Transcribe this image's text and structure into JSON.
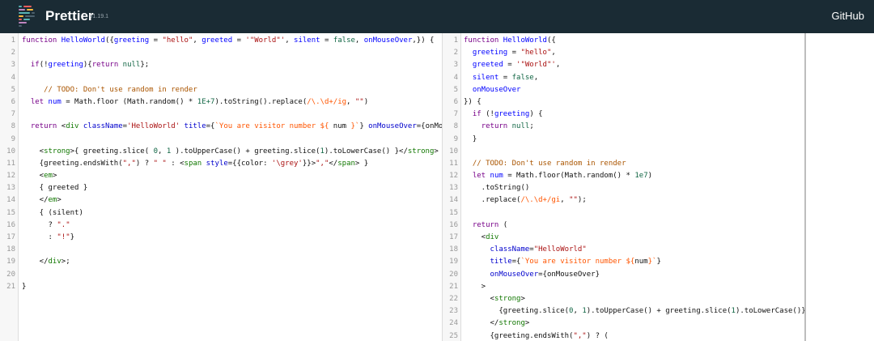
{
  "header": {
    "title": "Prettier",
    "version": "v1.19.1",
    "github_label": "GitHub"
  },
  "colors": {
    "header_bg": "#1a2b34",
    "keyword": "#770088",
    "def": "#0000ff",
    "string": "#aa1111",
    "comment": "#aa5500",
    "tag": "#117700",
    "attr": "#0000cc",
    "number": "#116644",
    "string2": "#ff5500"
  },
  "input": {
    "lines": [
      [
        {
          "t": "function ",
          "c": "kw"
        },
        {
          "t": "HelloWorld",
          "c": "def"
        },
        {
          "t": "({"
        },
        {
          "t": "greeting",
          "c": "def"
        },
        {
          "t": " = "
        },
        {
          "t": "\"hello\"",
          "c": "str"
        },
        {
          "t": ", "
        },
        {
          "t": "greeted",
          "c": "def"
        },
        {
          "t": " = "
        },
        {
          "t": "'\"World\"'",
          "c": "str"
        },
        {
          "t": ", "
        },
        {
          "t": "silent",
          "c": "def"
        },
        {
          "t": " = "
        },
        {
          "t": "false",
          "c": "atom"
        },
        {
          "t": ", "
        },
        {
          "t": "onMouseOver",
          "c": "def"
        },
        {
          "t": ",}) {"
        }
      ],
      [],
      [
        {
          "t": "  "
        },
        {
          "t": "if",
          "c": "kw"
        },
        {
          "t": "(!"
        },
        {
          "t": "greeting",
          "c": "var2"
        },
        {
          "t": "){"
        },
        {
          "t": "return",
          "c": "kw"
        },
        {
          "t": " "
        },
        {
          "t": "null",
          "c": "atom"
        },
        {
          "t": "};"
        }
      ],
      [],
      [
        {
          "t": "     "
        },
        {
          "t": "// TODO: Don't use random in render",
          "c": "com"
        }
      ],
      [
        {
          "t": "  "
        },
        {
          "t": "let",
          "c": "kw"
        },
        {
          "t": " "
        },
        {
          "t": "num",
          "c": "def"
        },
        {
          "t": " = Math.floor (Math.random() * "
        },
        {
          "t": "1E+7",
          "c": "num"
        },
        {
          "t": ").toString().replace("
        },
        {
          "t": "/\\.\\d+/ig",
          "c": "str2"
        },
        {
          "t": ", "
        },
        {
          "t": "\"\"",
          "c": "str"
        },
        {
          "t": ")"
        }
      ],
      [],
      [
        {
          "t": "  "
        },
        {
          "t": "return",
          "c": "kw"
        },
        {
          "t": " <"
        },
        {
          "t": "div",
          "c": "tag"
        },
        {
          "t": " "
        },
        {
          "t": "className",
          "c": "attr"
        },
        {
          "t": "="
        },
        {
          "t": "'HelloWorld'",
          "c": "str"
        },
        {
          "t": " "
        },
        {
          "t": "title",
          "c": "attr"
        },
        {
          "t": "={"
        },
        {
          "t": "`You are visitor number ${",
          "c": "str2"
        },
        {
          "t": " num ",
          "c": "v"
        },
        {
          "t": "}`",
          "c": "str2"
        },
        {
          "t": "} "
        },
        {
          "t": "onMouseOver",
          "c": "attr"
        },
        {
          "t": "={onMouseOver}>"
        }
      ],
      [],
      [
        {
          "t": "    <"
        },
        {
          "t": "strong",
          "c": "tag"
        },
        {
          "t": ">{ greeting.slice( "
        },
        {
          "t": "0",
          "c": "num"
        },
        {
          "t": ", "
        },
        {
          "t": "1",
          "c": "num"
        },
        {
          "t": " ).toUpperCase() + greeting.slice("
        },
        {
          "t": "1",
          "c": "num"
        },
        {
          "t": ").toLowerCase() }</"
        },
        {
          "t": "strong",
          "c": "tag"
        },
        {
          "t": ">"
        }
      ],
      [
        {
          "t": "    {greeting.endsWith("
        },
        {
          "t": "\",\"",
          "c": "str"
        },
        {
          "t": ") ? "
        },
        {
          "t": "\" \"",
          "c": "str"
        },
        {
          "t": " : <"
        },
        {
          "t": "span",
          "c": "tag"
        },
        {
          "t": " "
        },
        {
          "t": "style",
          "c": "attr"
        },
        {
          "t": "={{color: "
        },
        {
          "t": "'\\grey'",
          "c": "str"
        },
        {
          "t": "}}>"
        },
        {
          "t": "\",\"",
          "c": "str"
        },
        {
          "t": "</"
        },
        {
          "t": "span",
          "c": "tag"
        },
        {
          "t": "> }"
        }
      ],
      [
        {
          "t": "    <"
        },
        {
          "t": "em",
          "c": "tag"
        },
        {
          "t": ">"
        }
      ],
      [
        {
          "t": "    { greeted }"
        }
      ],
      [
        {
          "t": "    </"
        },
        {
          "t": "em",
          "c": "tag"
        },
        {
          "t": ">"
        }
      ],
      [
        {
          "t": "    { (silent)"
        }
      ],
      [
        {
          "t": "      ? "
        },
        {
          "t": "\".\"",
          "c": "str"
        }
      ],
      [
        {
          "t": "      : "
        },
        {
          "t": "\"!\"",
          "c": "str"
        },
        {
          "t": "}"
        }
      ],
      [],
      [
        {
          "t": "    </"
        },
        {
          "t": "div",
          "c": "tag"
        },
        {
          "t": ">;"
        }
      ],
      [],
      [
        {
          "t": "}"
        }
      ]
    ]
  },
  "output": {
    "lines": [
      [
        {
          "t": "function ",
          "c": "kw"
        },
        {
          "t": "HelloWorld",
          "c": "def"
        },
        {
          "t": "({"
        }
      ],
      [
        {
          "t": "  "
        },
        {
          "t": "greeting",
          "c": "def"
        },
        {
          "t": " = "
        },
        {
          "t": "\"hello\"",
          "c": "str"
        },
        {
          "t": ","
        }
      ],
      [
        {
          "t": "  "
        },
        {
          "t": "greeted",
          "c": "def"
        },
        {
          "t": " = "
        },
        {
          "t": "'\"World\"'",
          "c": "str"
        },
        {
          "t": ","
        }
      ],
      [
        {
          "t": "  "
        },
        {
          "t": "silent",
          "c": "def"
        },
        {
          "t": " = "
        },
        {
          "t": "false",
          "c": "atom"
        },
        {
          "t": ","
        }
      ],
      [
        {
          "t": "  "
        },
        {
          "t": "onMouseOver",
          "c": "def"
        }
      ],
      [
        {
          "t": "}) {"
        }
      ],
      [
        {
          "t": "  "
        },
        {
          "t": "if",
          "c": "kw"
        },
        {
          "t": " (!"
        },
        {
          "t": "greeting",
          "c": "var2"
        },
        {
          "t": ") {"
        }
      ],
      [
        {
          "t": "    "
        },
        {
          "t": "return",
          "c": "kw"
        },
        {
          "t": " "
        },
        {
          "t": "null",
          "c": "atom"
        },
        {
          "t": ";"
        }
      ],
      [
        {
          "t": "  }"
        }
      ],
      [],
      [
        {
          "t": "  "
        },
        {
          "t": "// TODO: Don't use random in render",
          "c": "com"
        }
      ],
      [
        {
          "t": "  "
        },
        {
          "t": "let",
          "c": "kw"
        },
        {
          "t": " "
        },
        {
          "t": "num",
          "c": "def"
        },
        {
          "t": " = Math.floor(Math.random() * "
        },
        {
          "t": "1e7",
          "c": "num"
        },
        {
          "t": ")"
        }
      ],
      [
        {
          "t": "    .toString()"
        }
      ],
      [
        {
          "t": "    .replace("
        },
        {
          "t": "/\\.\\d+/gi",
          "c": "str2"
        },
        {
          "t": ", "
        },
        {
          "t": "\"\"",
          "c": "str"
        },
        {
          "t": ");"
        }
      ],
      [],
      [
        {
          "t": "  "
        },
        {
          "t": "return",
          "c": "kw"
        },
        {
          "t": " ("
        }
      ],
      [
        {
          "t": "    <"
        },
        {
          "t": "div",
          "c": "tag"
        }
      ],
      [
        {
          "t": "      "
        },
        {
          "t": "className",
          "c": "attr"
        },
        {
          "t": "="
        },
        {
          "t": "\"HelloWorld\"",
          "c": "str"
        }
      ],
      [
        {
          "t": "      "
        },
        {
          "t": "title",
          "c": "attr"
        },
        {
          "t": "={"
        },
        {
          "t": "`You are visitor number ${",
          "c": "str2"
        },
        {
          "t": "num",
          "c": "v"
        },
        {
          "t": "}`",
          "c": "str2"
        },
        {
          "t": "}"
        }
      ],
      [
        {
          "t": "      "
        },
        {
          "t": "onMouseOver",
          "c": "attr"
        },
        {
          "t": "={onMouseOver}"
        }
      ],
      [
        {
          "t": "    >"
        }
      ],
      [
        {
          "t": "      <"
        },
        {
          "t": "strong",
          "c": "tag"
        },
        {
          "t": ">"
        }
      ],
      [
        {
          "t": "        {greeting.slice("
        },
        {
          "t": "0",
          "c": "num"
        },
        {
          "t": ", "
        },
        {
          "t": "1",
          "c": "num"
        },
        {
          "t": ").toUpperCase() + greeting.slice("
        },
        {
          "t": "1",
          "c": "num"
        },
        {
          "t": ").toLowerCase()}"
        }
      ],
      [
        {
          "t": "      </"
        },
        {
          "t": "strong",
          "c": "tag"
        },
        {
          "t": ">"
        }
      ],
      [
        {
          "t": "      {greeting.endsWith("
        },
        {
          "t": "\",\"",
          "c": "str"
        },
        {
          "t": ") ? ("
        }
      ]
    ]
  }
}
